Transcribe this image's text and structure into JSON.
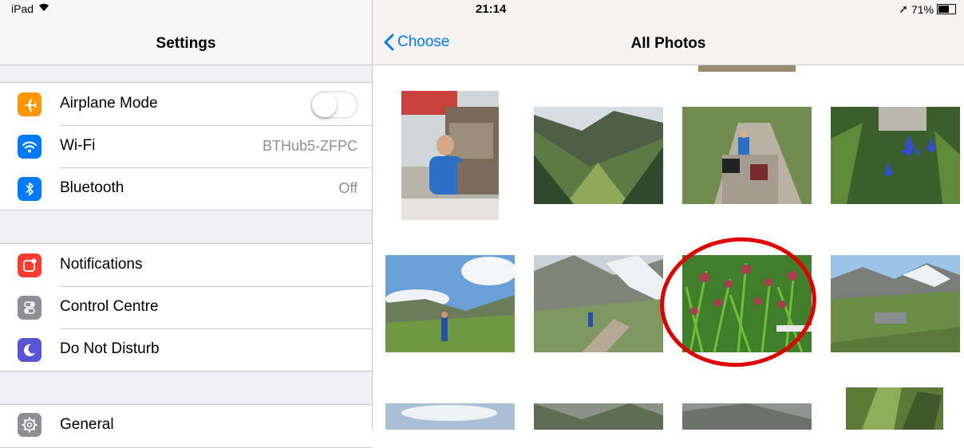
{
  "status_bar": {
    "carrier": "iPad",
    "time": "21:14",
    "battery": "71%",
    "battery_level": 0.71
  },
  "settings": {
    "title": "Settings",
    "group1": [
      {
        "label": "Airplane Mode",
        "icon": "airplane-icon",
        "color": "#ff9500",
        "toggle": false
      },
      {
        "label": "Wi-Fi",
        "icon": "wifi-icon",
        "color": "#007aff",
        "value": "BTHub5-ZFPC"
      },
      {
        "label": "Bluetooth",
        "icon": "bluetooth-icon",
        "color": "#007aff",
        "value": "Off"
      }
    ],
    "group2": [
      {
        "label": "Notifications",
        "icon": "notifications-icon",
        "color": "#ff3b30"
      },
      {
        "label": "Control Centre",
        "icon": "control-centre-icon",
        "color": "#8e8e93"
      },
      {
        "label": "Do Not Disturb",
        "icon": "moon-icon",
        "color": "#5856d6"
      }
    ],
    "group3": [
      {
        "label": "General",
        "icon": "gear-icon",
        "color": "#8e8e93"
      }
    ]
  },
  "photos": {
    "back_label": "Choose",
    "title": "All Photos",
    "selected_photo": "red-flowers",
    "items": [
      "man-at-cafe",
      "green-valley",
      "hikers-on-trail",
      "blue-gentian-flowers",
      "hiker-cloudy-sky",
      "hiker-mountain-path",
      "red-flowers",
      "mountain-hut",
      "clouds-partial",
      "rocks-partial",
      "stone-partial",
      "trees-partial"
    ]
  },
  "colors": {
    "accent": "#007aff",
    "highlight_circle": "#e00000"
  }
}
